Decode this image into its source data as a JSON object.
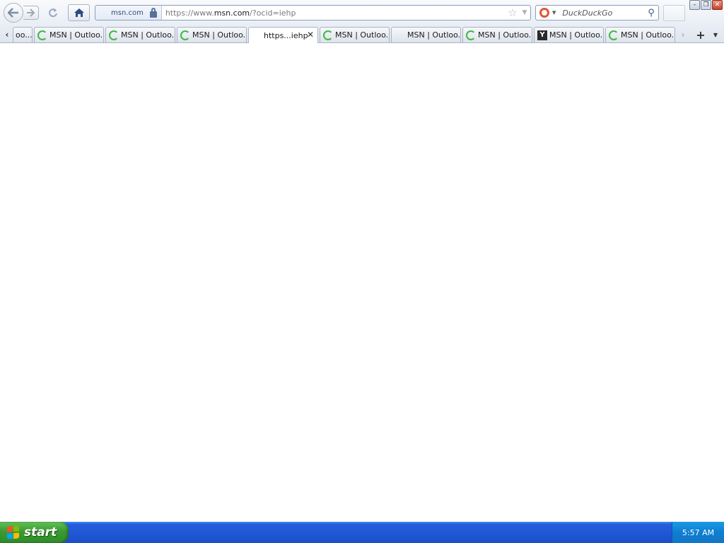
{
  "urlbar": {
    "identity": "msn.com",
    "scheme": "https://www.",
    "host": "msn.com",
    "path": "/?ocid=iehp"
  },
  "search": {
    "placeholder": "DuckDuckGo"
  },
  "tabs": [
    {
      "label": "oo...",
      "favicon": "none",
      "selected": false
    },
    {
      "label": "MSN | Outloo...",
      "favicon": "loading-spinner",
      "selected": false
    },
    {
      "label": "MSN | Outloo...",
      "favicon": "loading-spinner",
      "selected": false
    },
    {
      "label": "MSN | Outloo...",
      "favicon": "loading-spinner",
      "selected": false
    },
    {
      "label": "https...iehp",
      "favicon": "none",
      "selected": true
    },
    {
      "label": "MSN | Outloo...",
      "favicon": "loading-spinner",
      "selected": false
    },
    {
      "label": "MSN | Outloo...",
      "favicon": "none",
      "selected": false
    },
    {
      "label": "MSN | Outloo...",
      "favicon": "loading-spinner",
      "selected": false
    },
    {
      "label": "MSN | Outloo...",
      "favicon": "y-logo",
      "selected": false
    },
    {
      "label": "MSN | Outloo...",
      "favicon": "loading-spinner",
      "selected": false
    }
  ],
  "tab_controls": {
    "close": "✕",
    "new_tab": "+",
    "scroll_left": "‹",
    "scroll_right": "›"
  },
  "taskbar": {
    "start_label": "start",
    "clock": "5:57 AM"
  },
  "colors": {
    "taskbar": "#245edb",
    "start_button": "#3a9a31",
    "tray": "#0f7ed0",
    "spinner": "#3fb93f"
  }
}
